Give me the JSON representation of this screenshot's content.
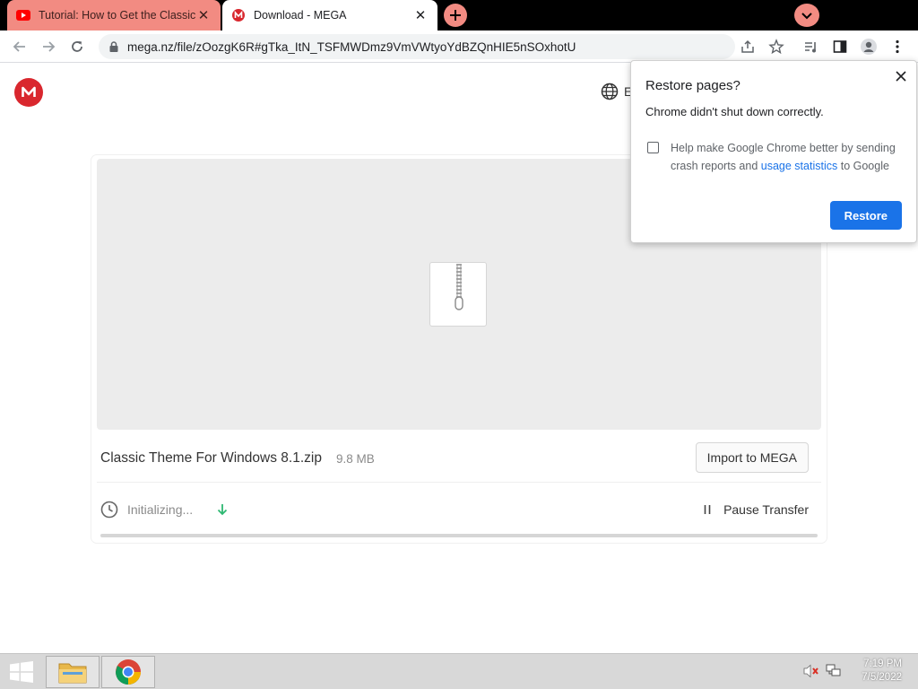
{
  "tabs": [
    {
      "title": "Tutorial: How to Get the Classic Theme",
      "favicon": "youtube-icon",
      "active": false
    },
    {
      "title": "Download - MEGA",
      "favicon": "mega-icon",
      "active": true
    }
  ],
  "toolbar": {
    "url": "mega.nz/file/zOozgK6R#gTka_ItN_TSFMWDmz9VmVWtyoYdBZQnHIE5nSOxhotU"
  },
  "page": {
    "language_label": "E",
    "file_name": "Classic Theme For Windows 8.1.zip",
    "file_size": "9.8 MB",
    "import_label": "Import to MEGA",
    "status": "Initializing...",
    "pause_label": "Pause Transfer",
    "progress": 0
  },
  "popup": {
    "title": "Restore pages?",
    "message": "Chrome didn't shut down correctly.",
    "checkbox_text": "Help make Google Chrome better by sending crash reports and",
    "link_text": "usage statistics",
    "checkbox_suffix": "to Google",
    "button_label": "Restore"
  },
  "taskbar": {
    "time": "7:19 PM",
    "date": "7/5/2022"
  },
  "colors": {
    "tab_inactive": "#f28b82",
    "mega_red": "#d9272e",
    "chrome_blue": "#1a73e8",
    "download_green": "#2eb872"
  }
}
